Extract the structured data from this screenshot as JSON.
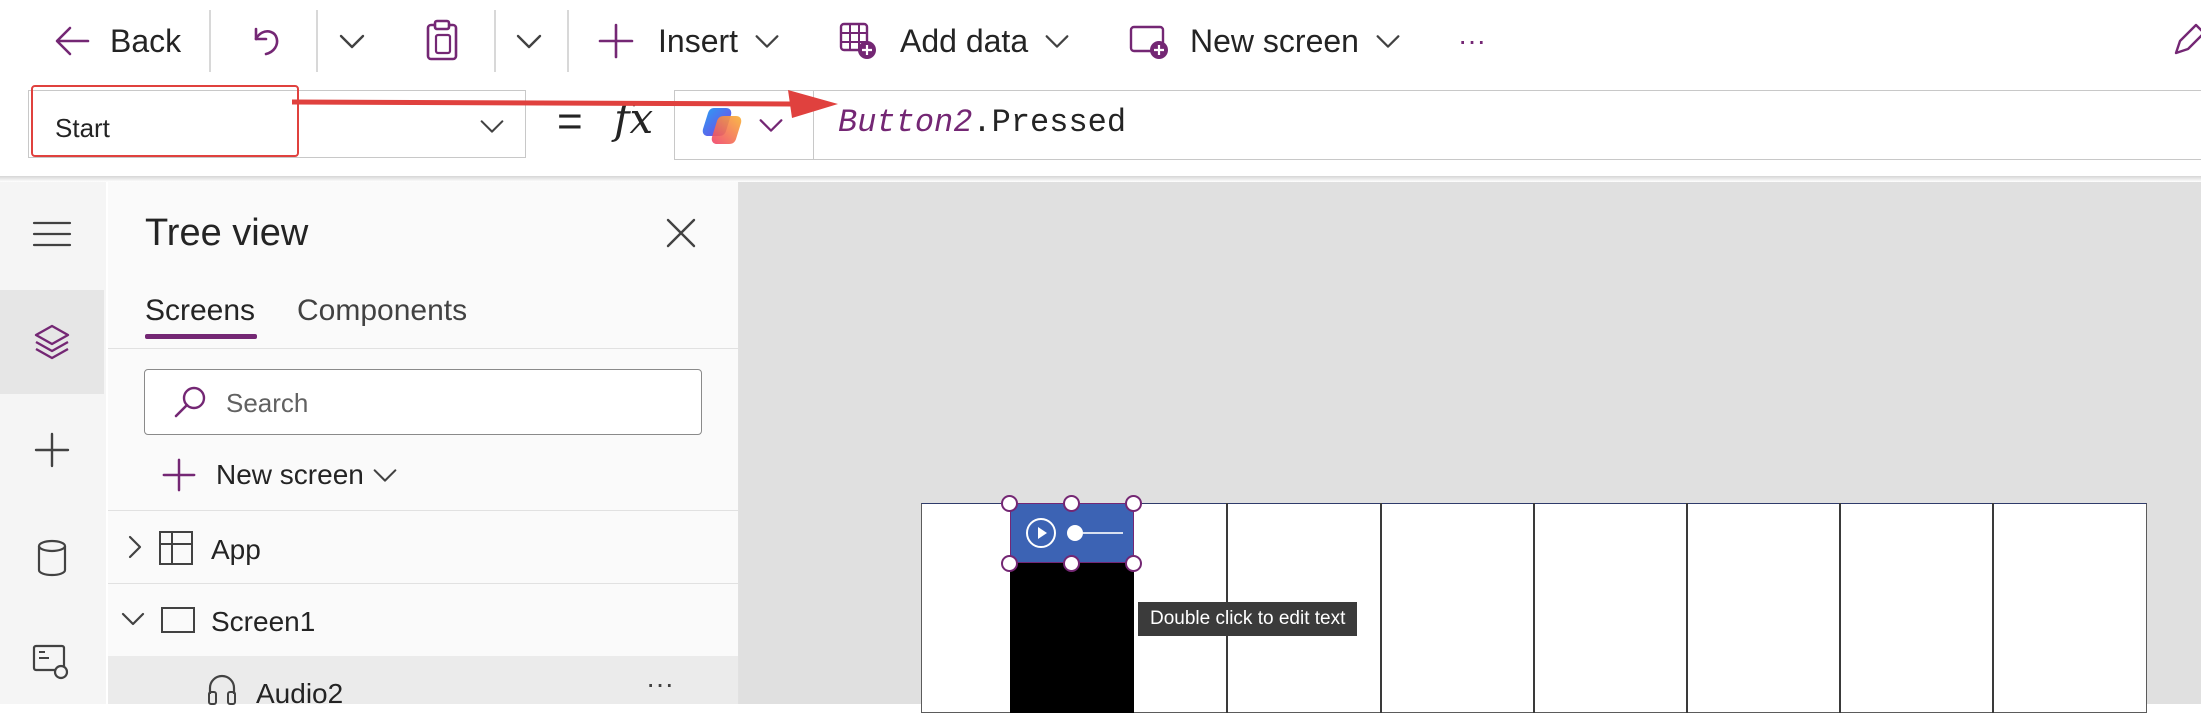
{
  "toolbar": {
    "back_label": "Back",
    "insert_label": "Insert",
    "add_data_label": "Add data",
    "new_screen_label": "New screen",
    "more_label": "···"
  },
  "formula_bar": {
    "property": "Start",
    "equals": "=",
    "fx": "fx",
    "formula_control": "Button2",
    "formula_rest": ".Pressed"
  },
  "tree_view": {
    "title": "Tree view",
    "tabs": [
      {
        "label": "Screens",
        "selected": true
      },
      {
        "label": "Components",
        "selected": false
      }
    ],
    "search_placeholder": "Search",
    "new_screen_label": "New screen",
    "nodes": [
      {
        "label": "App",
        "icon": "app-icon"
      },
      {
        "label": "Screen1",
        "icon": "screen-icon"
      },
      {
        "label": "Audio2",
        "icon": "headphones-icon",
        "more": "···"
      }
    ]
  },
  "canvas": {
    "tooltip": "Double click to edit text"
  },
  "colors": {
    "accent": "#742774",
    "annotation": "#e0413e",
    "audio_control": "#3c63b4"
  }
}
